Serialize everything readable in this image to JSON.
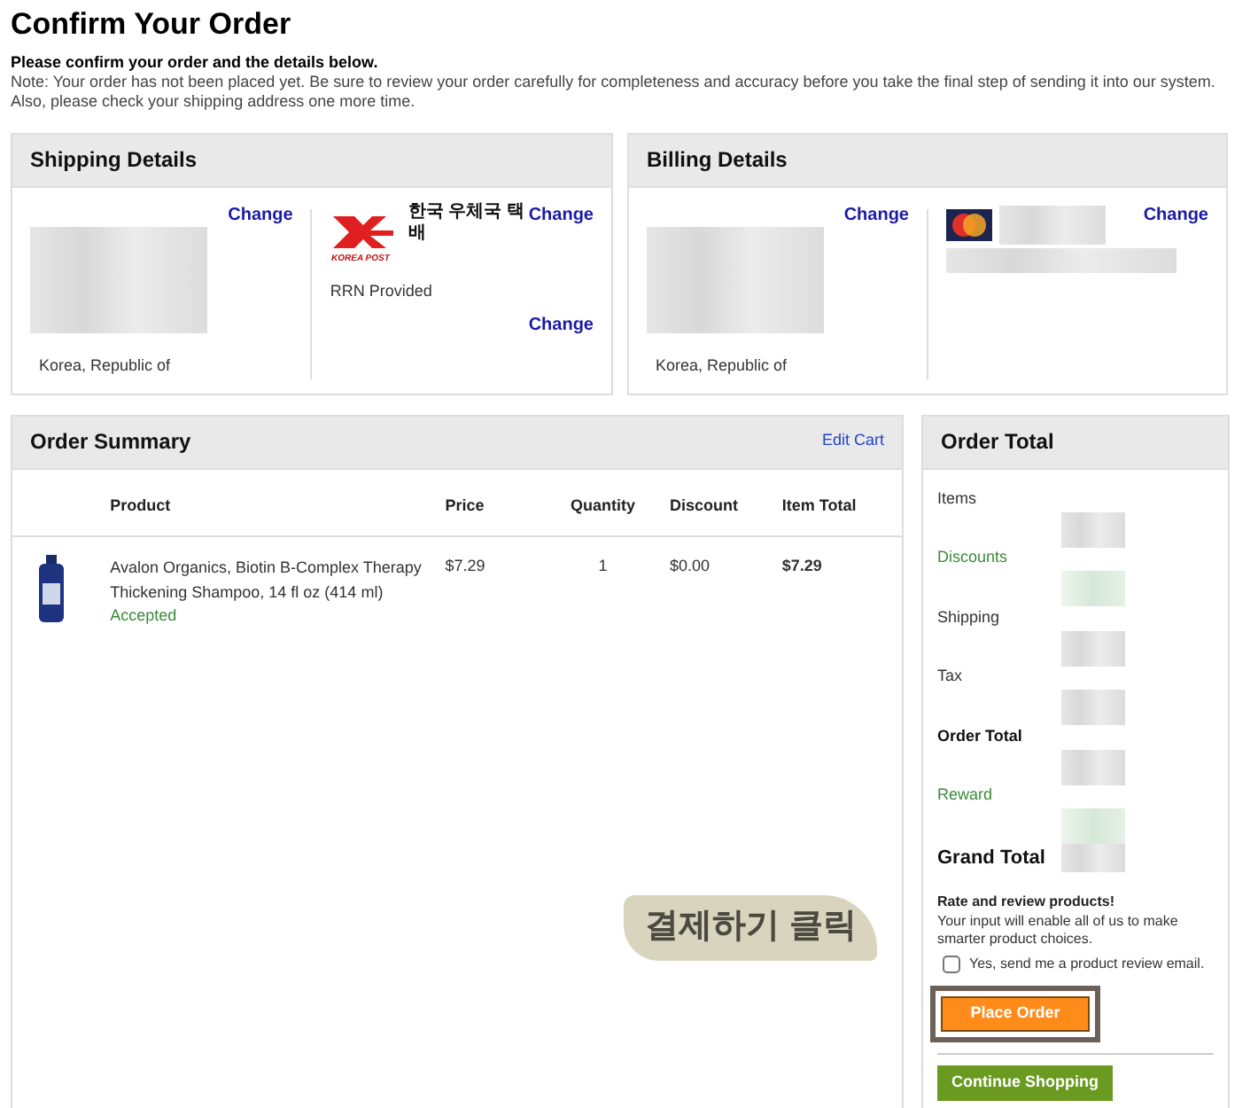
{
  "page": {
    "title": "Confirm Your Order",
    "intro": "Please confirm your order and the details below.",
    "note": "Note: Your order has not been placed yet. Be sure to review your order carefully for completeness and accuracy before you take the final step of sending it into our system.",
    "note2": "Also, please check your shipping address one more time."
  },
  "shipping": {
    "title": "Shipping Details",
    "address": {
      "change": "Change",
      "country": "Korea, Republic of"
    },
    "method": {
      "logo_text": "KOREA POST",
      "name": "한국 우체국 택배",
      "note": "RRN Provided",
      "change": "Change",
      "change2": "Change"
    }
  },
  "billing": {
    "title": "Billing Details",
    "address": {
      "change": "Change",
      "country": "Korea, Republic of"
    },
    "card": {
      "change": "Change"
    }
  },
  "order_summary": {
    "title": "Order Summary",
    "edit_link": "Edit Cart",
    "columns": [
      "Product",
      "Price",
      "Quantity",
      "Discount",
      "Item Total"
    ],
    "rows": [
      {
        "product": "Avalon Organics, Biotin B-Complex Therapy Thickening Shampoo, 14 fl oz (414 ml)",
        "status": "Accepted",
        "price": "$7.29",
        "quantity": "1",
        "discount": "$0.00",
        "total": "$7.29"
      }
    ]
  },
  "order_total": {
    "title": "Order Total",
    "lines": [
      {
        "label": "Items",
        "kind": "plain"
      },
      {
        "label": "Discounts",
        "kind": "green"
      },
      {
        "label": "Shipping",
        "kind": "plain"
      },
      {
        "label": "Tax",
        "kind": "plain"
      },
      {
        "label": "Order Total",
        "kind": "bold"
      },
      {
        "label": "Reward",
        "kind": "green"
      },
      {
        "label": "Grand Total",
        "kind": "grand"
      }
    ],
    "review_title": "Rate and review products!",
    "review_text": "Your input will enable all of us to make smarter product choices.",
    "review_checkbox": {
      "label": "Yes, send me a product review email.",
      "checked": false
    },
    "place_order": "Place Order",
    "continue_shopping": "Continue Shopping"
  },
  "annotation": {
    "text": "결제하기 클릭"
  }
}
